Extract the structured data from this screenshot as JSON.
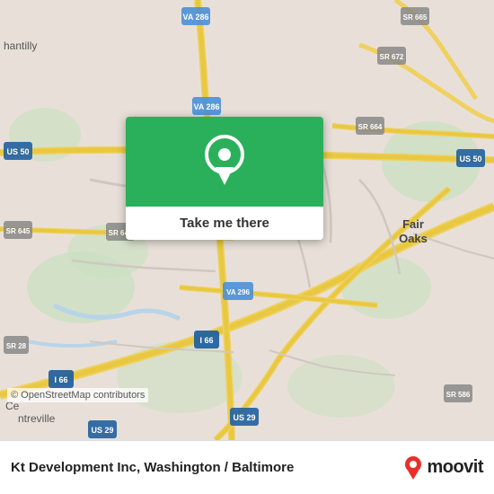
{
  "map": {
    "background_color": "#e8e0d8"
  },
  "popup": {
    "button_label": "Take me there",
    "pin_color": "#2ab05a"
  },
  "bottom_bar": {
    "copyright": "© OpenStreetMap contributors",
    "location_title": "Kt Development Inc, Washington / Baltimore",
    "moovit_label": "moovit"
  }
}
